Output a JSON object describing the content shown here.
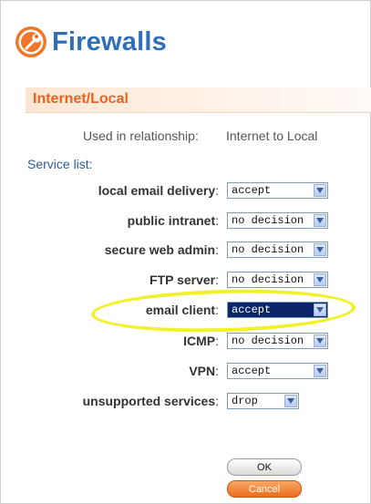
{
  "header": {
    "title": "Firewalls",
    "logo_icon": "wrench-icon",
    "accent": "#e8641e",
    "title_color": "#2f6fb7"
  },
  "section": {
    "title": "Internet/Local"
  },
  "relationship": {
    "label": "Used in relationship:",
    "value": "Internet to Local"
  },
  "service_list": {
    "label": "Service list:",
    "rows": [
      {
        "label": "local email delivery",
        "value": "accept"
      },
      {
        "label": "public intranet",
        "value": "no decision"
      },
      {
        "label": "secure web admin",
        "value": "no decision"
      },
      {
        "label": "FTP server",
        "value": "no decision"
      },
      {
        "label": "email client",
        "value": "accept"
      },
      {
        "label": "ICMP",
        "value": "no decision"
      },
      {
        "label": "VPN",
        "value": "accept"
      },
      {
        "label": "unsupported services",
        "value": "drop"
      }
    ],
    "colon": ":"
  },
  "buttons": {
    "ok": "OK",
    "cancel": "Cancel"
  }
}
